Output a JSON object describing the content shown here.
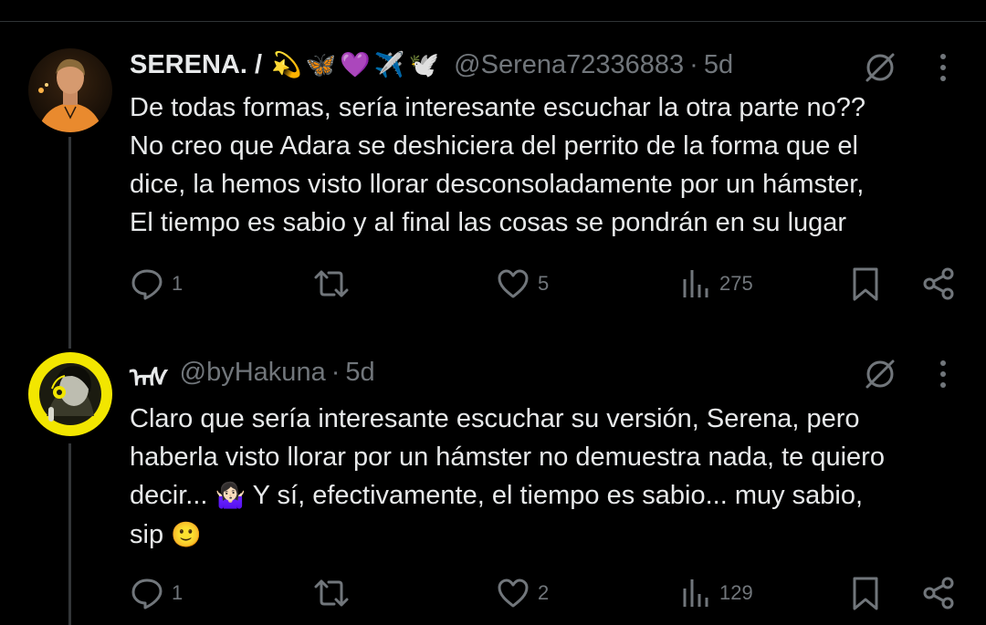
{
  "tweets": [
    {
      "display_name": "SERENA. /",
      "emojis": [
        "💫",
        "🦋",
        "💜",
        "✈️",
        "🕊️"
      ],
      "handle": "@Serena72336883",
      "separator": "·",
      "time": "5d",
      "text_lines": [
        "De todas formas, sería interesante escuchar la otra parte no??",
        "No creo que Adara se deshiciera del perrito de la forma que el",
        "dice, la hemos visto llorar desconsoladamente por un hámster,",
        "El tiempo es sabio y al final las cosas se pondrán en su lugar"
      ],
      "actions": {
        "replies": "1",
        "retweets": "",
        "likes": "5",
        "views": "275"
      }
    },
    {
      "display_name": "ᠠᠰ",
      "emojis": [],
      "handle": "@byHakuna",
      "separator": "·",
      "time": "5d",
      "text_lines": [
        "Claro que sería interesante escuchar su versión, Serena, pero",
        "haberla visto llorar por un hámster no demuestra nada, te quiero",
        "decir... ",
        "sip "
      ],
      "line3_emoji": "🤷🏻‍♀️",
      "line3_rest": " Y sí, efectivamente, el tiempo es sabio... muy sabio,",
      "line4_emoji": "🙂",
      "actions": {
        "replies": "1",
        "retweets": "",
        "likes": "2",
        "views": "129"
      }
    }
  ],
  "colors": {
    "background": "#000000",
    "text": "#e7e9ea",
    "secondary": "#71767b",
    "divider": "#2f3336"
  },
  "icons": {
    "reply": "reply-icon",
    "retweet": "retweet-icon",
    "like": "like-icon",
    "views": "views-icon",
    "bookmark": "bookmark-icon",
    "share": "share-icon",
    "grok": "grok-icon",
    "more": "more-icon"
  }
}
